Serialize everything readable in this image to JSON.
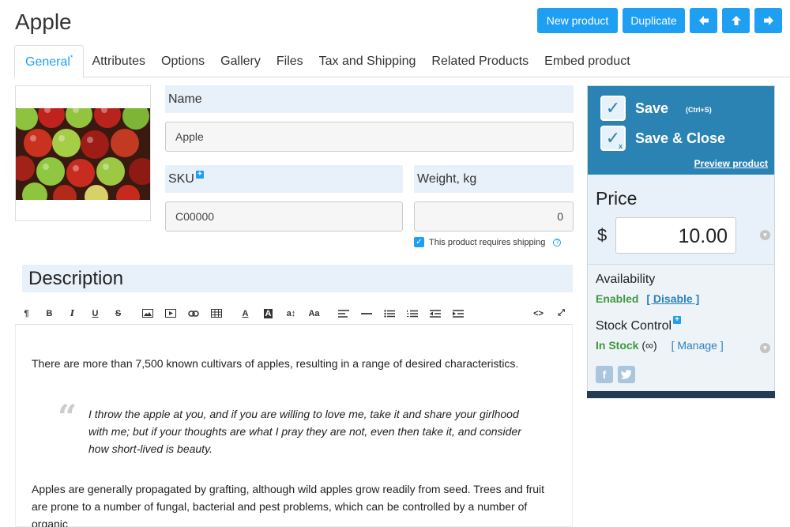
{
  "page": {
    "title": "Apple"
  },
  "actions": {
    "new_product": "New product",
    "duplicate": "Duplicate"
  },
  "tabs": [
    {
      "label": "General",
      "marker": "*"
    },
    {
      "label": "Attributes"
    },
    {
      "label": "Options"
    },
    {
      "label": "Gallery"
    },
    {
      "label": "Files"
    },
    {
      "label": "Tax and Shipping"
    },
    {
      "label": "Related Products"
    },
    {
      "label": "Embed product"
    }
  ],
  "fields": {
    "name_label": "Name",
    "name_value": "Apple",
    "sku_label": "SKU",
    "sku_value": "C00000",
    "weight_label": "Weight, kg",
    "weight_value": "0",
    "shipping_checkbox": "This product requires shipping",
    "shipping_checked": true
  },
  "description": {
    "title": "Description",
    "paragraph1": "There are more than 7,500 known cultivars of apples, resulting in a range of desired characteristics.",
    "quote_mark": "“",
    "quote": "I throw the apple at you, and if you are willing to love me, take it and share your girlhood with me; but if your thoughts are what I pray they are not, even then take it, and consider how short-lived is beauty.",
    "paragraph2": "Apples are generally propagated by grafting, although wild apples grow readily from seed. Trees and fruit are prone to a number of fungal, bacterial and pest problems, which can be controlled by a number of organic"
  },
  "toolbar": {
    "paragraph": "¶",
    "bold": "B",
    "italic": "I",
    "underline": "U",
    "strike": "S",
    "font_color": "A",
    "bg_color": "A",
    "font_size": "a↕",
    "case": "Aa",
    "code": "<>",
    "fullscreen": "⤢"
  },
  "panel": {
    "save": "Save",
    "save_shortcut": "(Ctrl+S)",
    "save_close": "Save & Close",
    "preview": "Preview product",
    "price_label": "Price",
    "currency": "$",
    "price_value": "10.00",
    "availability_label": "Availability",
    "availability_state": "Enabled",
    "availability_link": "[ Disable ]",
    "stock_label": "Stock Control",
    "stock_state": "In Stock",
    "stock_infinite": "(∞)",
    "stock_link": "[ Manage ]"
  },
  "colors": {
    "accent": "#1e9ff2",
    "panel_header": "#2b83b4",
    "label_bg": "#e8f0f9",
    "enabled": "#3d9a3d"
  }
}
